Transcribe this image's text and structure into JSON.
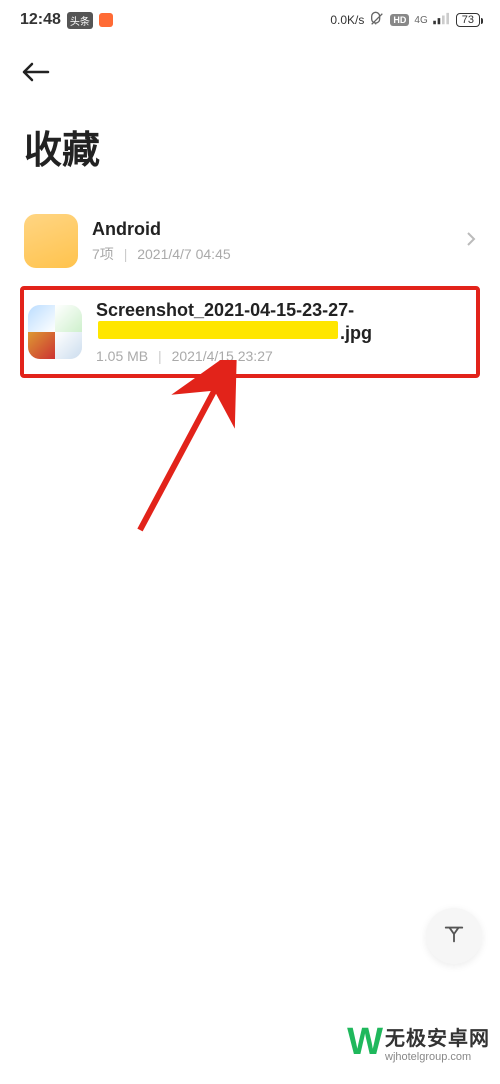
{
  "status": {
    "time": "12:48",
    "badge1": "头条",
    "speed": "0.0K/s",
    "hd": "HD",
    "net": "4G",
    "battery": "73"
  },
  "page": {
    "title": "收藏"
  },
  "items": [
    {
      "name": "Android",
      "count": "7项",
      "date": "2021/4/7 04:45"
    },
    {
      "name_prefix": "Screenshot_2021-04-15-23-27-",
      "name_suffix": ".jpg",
      "size": "1.05 MB",
      "date": "2021/4/15 23:27"
    }
  ],
  "watermark": {
    "w": "W",
    "cn": "无极安卓网",
    "url": "wjhotelgroup.com"
  }
}
